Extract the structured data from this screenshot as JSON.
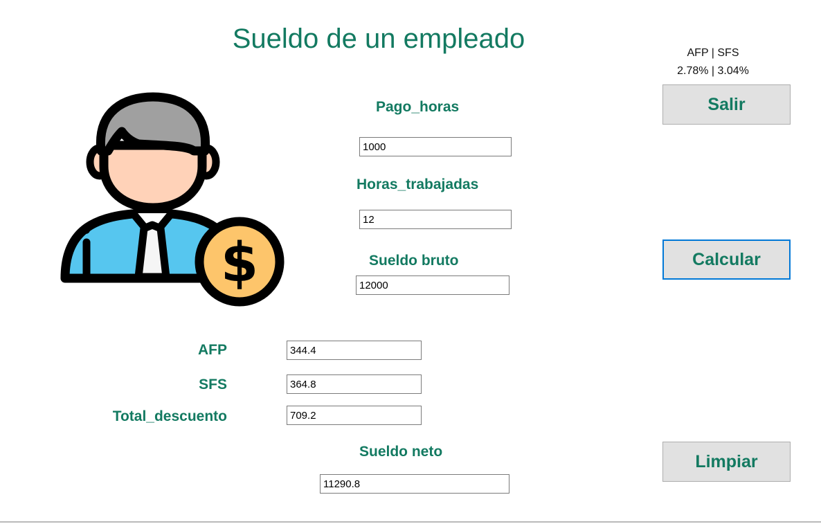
{
  "window": {
    "title": "Sueldo de un empleado",
    "rates_header": "AFP | SFS",
    "rates_values": "2.78% | 3.04%"
  },
  "labels": {
    "pago_horas": "Pago_horas",
    "horas_trabajadas": "Horas_trabajadas",
    "sueldo_bruto": "Sueldo bruto",
    "afp": "AFP",
    "sfs": "SFS",
    "total_descuento": "Total_descuento",
    "sueldo_neto": "Sueldo neto"
  },
  "fields": {
    "pago_horas": "1000",
    "horas_trabajadas": "12",
    "sueldo_bruto": "12000",
    "afp": "344.4",
    "sfs": "364.8",
    "total_descuento": "709.2",
    "sueldo_neto": "11290.8"
  },
  "buttons": {
    "salir": "Salir",
    "calcular": "Calcular",
    "limpiar": "Limpiar"
  },
  "icons": {
    "employee": "employee-salary-icon"
  },
  "colors": {
    "accent": "#137a61",
    "button_bg": "#e1e1e1",
    "focus_border": "#0078d7"
  }
}
